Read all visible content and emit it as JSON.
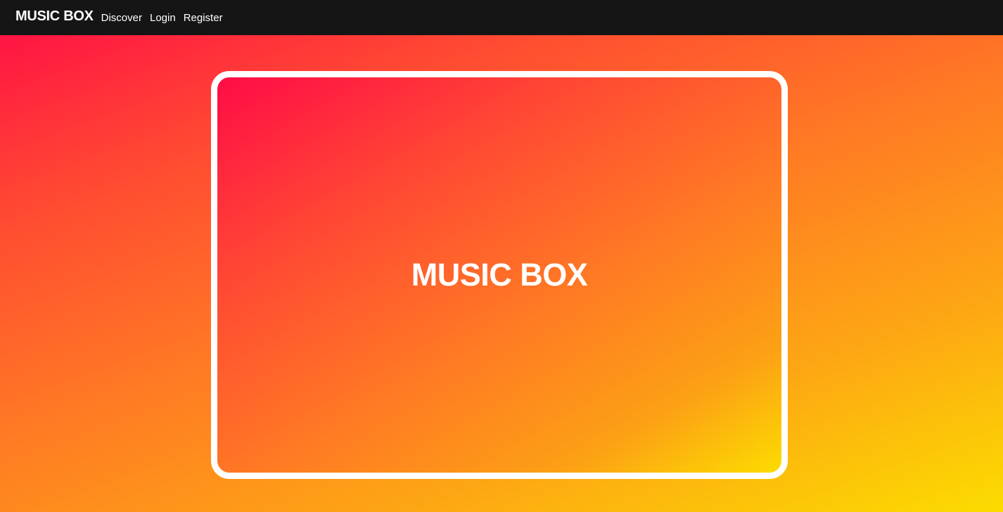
{
  "navbar": {
    "brand": "MUSIC BOX",
    "links": [
      {
        "label": "Discover"
      },
      {
        "label": "Login"
      },
      {
        "label": "Register"
      }
    ]
  },
  "hero": {
    "title": "MUSIC BOX"
  },
  "colors": {
    "navbar_bg": "#151515",
    "gradient_start": "#ff0a47",
    "gradient_mid": "#ff7a24",
    "gradient_end": "#fcdc00",
    "frame_border": "#ffffff"
  }
}
